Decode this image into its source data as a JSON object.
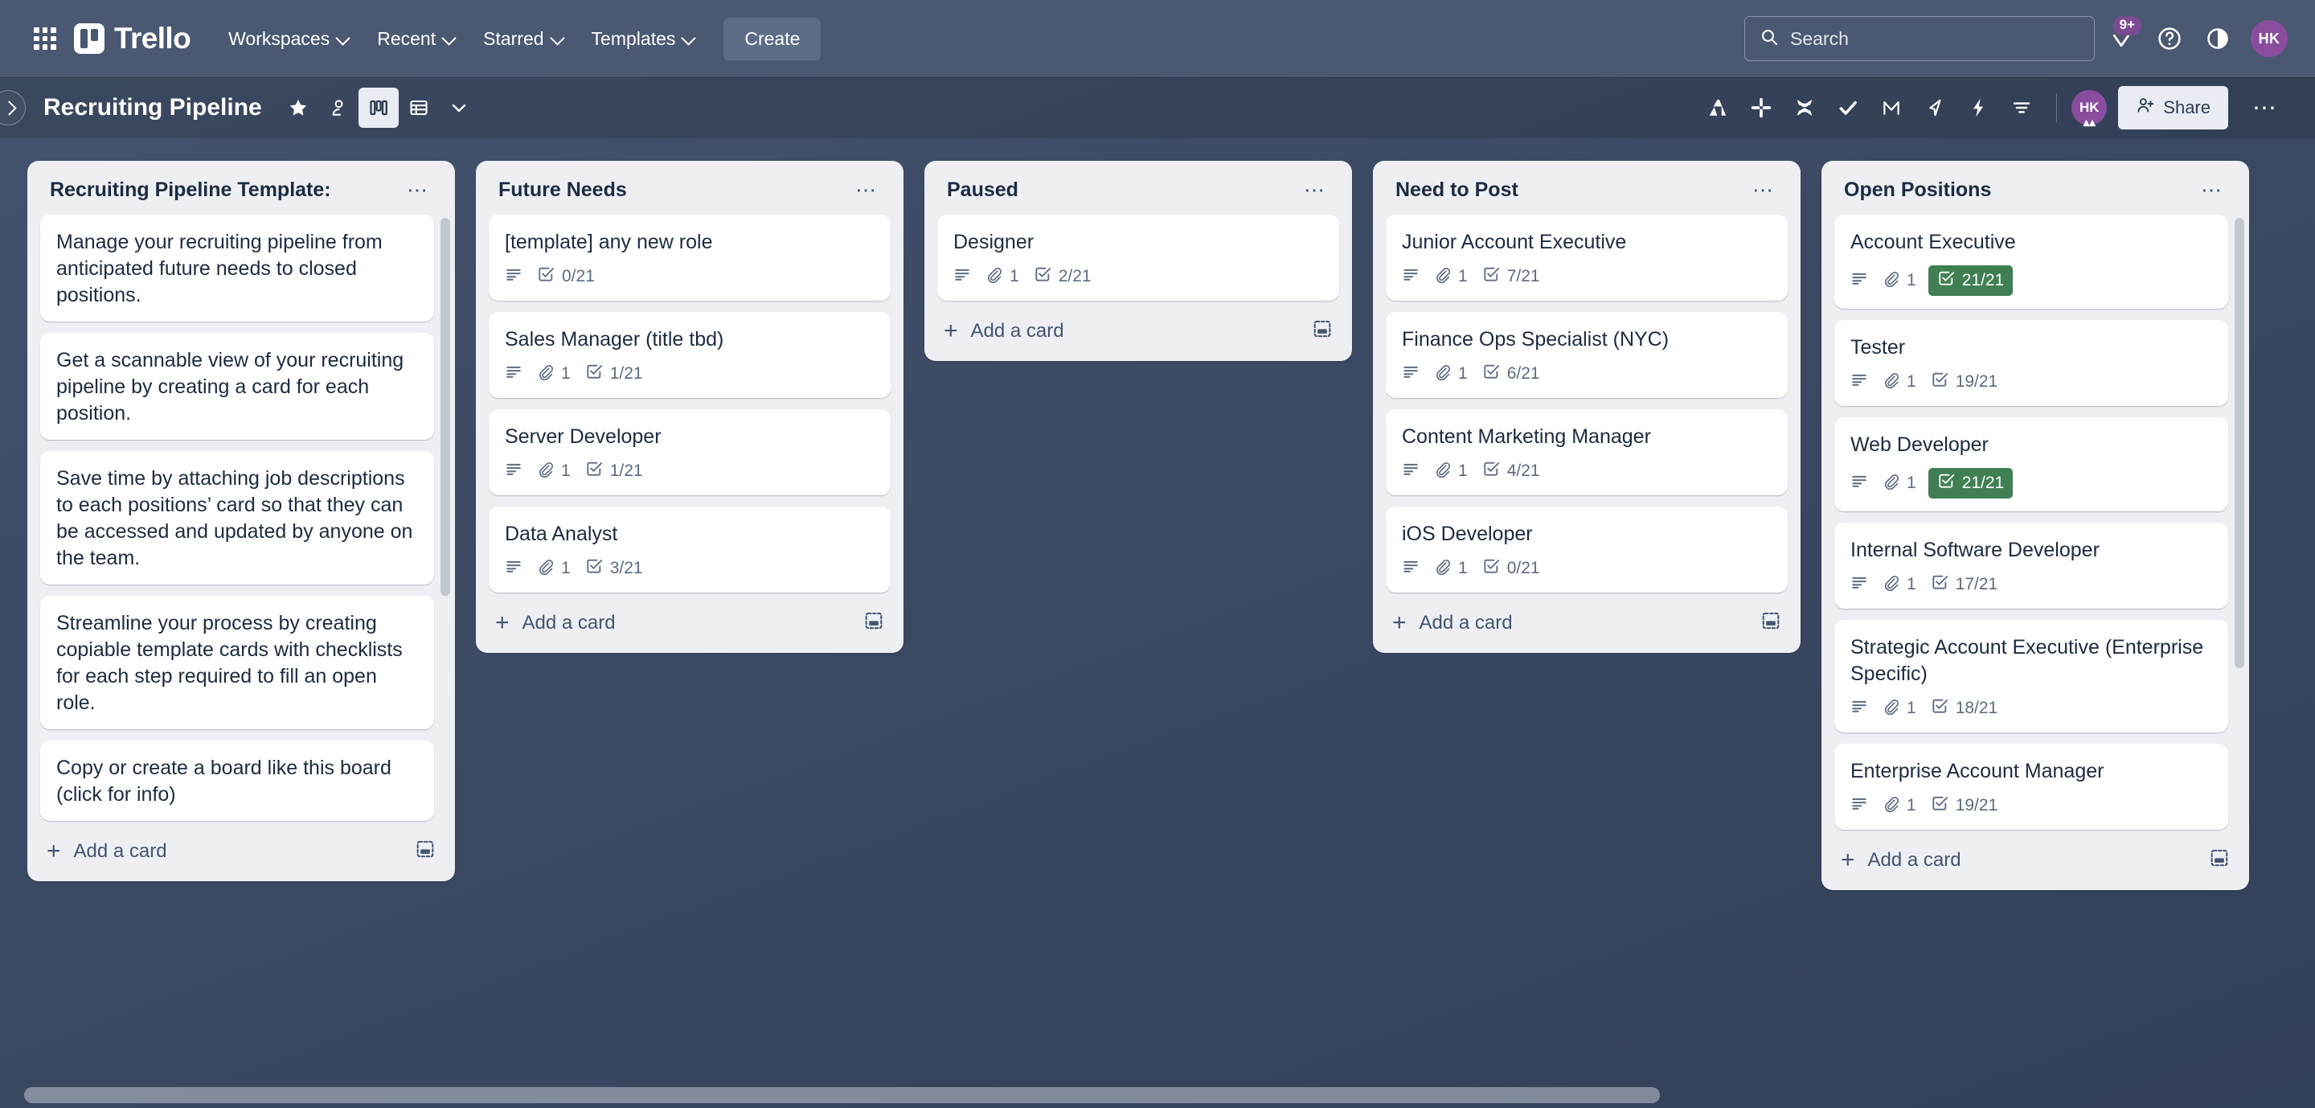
{
  "topnav": {
    "apps_icon": "grid-apps-icon",
    "brand": "Trello",
    "items": [
      {
        "label": "Workspaces",
        "has_caret": true
      },
      {
        "label": "Recent",
        "has_caret": true
      },
      {
        "label": "Starred",
        "has_caret": true
      },
      {
        "label": "Templates",
        "has_caret": true
      }
    ],
    "create_label": "Create",
    "search": {
      "placeholder": "Search",
      "value": "",
      "icon": "search-icon"
    },
    "notifications": {
      "icon": "notification-bell-icon",
      "badge": "9+"
    },
    "help": {
      "icon": "help-circle-icon"
    },
    "theme": {
      "icon": "half-circle-contrast-icon"
    },
    "account": {
      "initials": "HK",
      "color": "#8a4d9e"
    }
  },
  "board_header": {
    "sidebar_toggle_icon": "chevron-right-icon",
    "title": "Recruiting Pipeline",
    "star_icon": "star-icon",
    "visibility_icon": "workspace-visible-icon",
    "view_board_icon": "board-view-icon",
    "view_table_icon": "table-view-icon",
    "view_more_icon": "chevron-down-icon",
    "powerups": [
      {
        "name": "atlassian-icon"
      },
      {
        "name": "slack-icon"
      },
      {
        "name": "confluence-icon"
      },
      {
        "name": "checkmark-icon"
      },
      {
        "name": "gmail-m-icon"
      },
      {
        "name": "jira-icon"
      },
      {
        "name": "automation-bolt-icon"
      },
      {
        "name": "filter-icon"
      }
    ],
    "member": {
      "initials": "HK",
      "color": "#8a4d9e"
    },
    "share_label": "Share",
    "share_icon": "person-add-icon",
    "more_icon": "ellipsis-icon"
  },
  "add_card_label": "Add a card",
  "card_template_icon": "card-template-icon",
  "list_menu_icon": "ellipsis-icon",
  "colors": {
    "nav_background": "#4a5872",
    "board_background": "#3c4a63",
    "list_background": "#edeff3",
    "card_background": "#ffffff",
    "badge_complete_green": "#3f7f53",
    "avatar_purple": "#8a4d9e",
    "text_dark": "#1d2b41"
  },
  "lists": [
    {
      "title": "Recruiting Pipeline Template:",
      "scrollbar": true,
      "cards": [
        {
          "title": "Manage your recruiting pipeline from anticipated future needs to closed positions.",
          "badges": []
        },
        {
          "title": "Get a scannable view of your recruiting pipeline by creating a card for each position.",
          "badges": []
        },
        {
          "title": "Save time by attaching job descriptions to each positions’ card so that they can be accessed and updated by anyone on the team.",
          "badges": []
        },
        {
          "title": "Streamline your process by creating copiable template cards with checklists for each step required to fill an open role.",
          "badges": []
        },
        {
          "title": "Copy or create a board like this board (click for info)",
          "badges": []
        }
      ]
    },
    {
      "title": "Future Needs",
      "scrollbar": false,
      "cards": [
        {
          "title": "[template] any new role",
          "badges": [
            {
              "type": "description"
            },
            {
              "type": "checklist",
              "text": "0/21",
              "complete": false
            }
          ]
        },
        {
          "title": "Sales Manager (title tbd)",
          "badges": [
            {
              "type": "description"
            },
            {
              "type": "attachment",
              "text": "1"
            },
            {
              "type": "checklist",
              "text": "1/21",
              "complete": false
            }
          ]
        },
        {
          "title": "Server Developer",
          "badges": [
            {
              "type": "description"
            },
            {
              "type": "attachment",
              "text": "1"
            },
            {
              "type": "checklist",
              "text": "1/21",
              "complete": false
            }
          ]
        },
        {
          "title": "Data Analyst",
          "badges": [
            {
              "type": "description"
            },
            {
              "type": "attachment",
              "text": "1"
            },
            {
              "type": "checklist",
              "text": "3/21",
              "complete": false
            }
          ]
        }
      ]
    },
    {
      "title": "Paused",
      "scrollbar": false,
      "cards": [
        {
          "title": "Designer",
          "badges": [
            {
              "type": "description"
            },
            {
              "type": "attachment",
              "text": "1"
            },
            {
              "type": "checklist",
              "text": "2/21",
              "complete": false
            }
          ]
        }
      ]
    },
    {
      "title": "Need to Post",
      "scrollbar": false,
      "cards": [
        {
          "title": "Junior Account Executive",
          "badges": [
            {
              "type": "description"
            },
            {
              "type": "attachment",
              "text": "1"
            },
            {
              "type": "checklist",
              "text": "7/21",
              "complete": false
            }
          ]
        },
        {
          "title": "Finance Ops Specialist (NYC)",
          "badges": [
            {
              "type": "description"
            },
            {
              "type": "attachment",
              "text": "1"
            },
            {
              "type": "checklist",
              "text": "6/21",
              "complete": false
            }
          ]
        },
        {
          "title": "Content Marketing Manager",
          "badges": [
            {
              "type": "description"
            },
            {
              "type": "attachment",
              "text": "1"
            },
            {
              "type": "checklist",
              "text": "4/21",
              "complete": false
            }
          ]
        },
        {
          "title": "iOS Developer",
          "badges": [
            {
              "type": "description"
            },
            {
              "type": "attachment",
              "text": "1"
            },
            {
              "type": "checklist",
              "text": "0/21",
              "complete": false
            }
          ]
        }
      ]
    },
    {
      "title": "Open Positions",
      "scrollbar": true,
      "cards": [
        {
          "title": "Account Executive",
          "badges": [
            {
              "type": "description"
            },
            {
              "type": "attachment",
              "text": "1"
            },
            {
              "type": "checklist",
              "text": "21/21",
              "complete": true
            }
          ]
        },
        {
          "title": "Tester",
          "badges": [
            {
              "type": "description"
            },
            {
              "type": "attachment",
              "text": "1"
            },
            {
              "type": "checklist",
              "text": "19/21",
              "complete": false
            }
          ]
        },
        {
          "title": "Web Developer",
          "badges": [
            {
              "type": "description"
            },
            {
              "type": "attachment",
              "text": "1"
            },
            {
              "type": "checklist",
              "text": "21/21",
              "complete": true
            }
          ]
        },
        {
          "title": "Internal Software Developer",
          "badges": [
            {
              "type": "description"
            },
            {
              "type": "attachment",
              "text": "1"
            },
            {
              "type": "checklist",
              "text": "17/21",
              "complete": false
            }
          ]
        },
        {
          "title": "Strategic Account Executive (Enterprise Specific)",
          "badges": [
            {
              "type": "description"
            },
            {
              "type": "attachment",
              "text": "1"
            },
            {
              "type": "checklist",
              "text": "18/21",
              "complete": false
            }
          ]
        },
        {
          "title": "Enterprise Account Manager",
          "badges": [
            {
              "type": "description"
            },
            {
              "type": "attachment",
              "text": "1"
            },
            {
              "type": "checklist",
              "text": "19/21",
              "complete": false
            }
          ]
        }
      ]
    }
  ]
}
